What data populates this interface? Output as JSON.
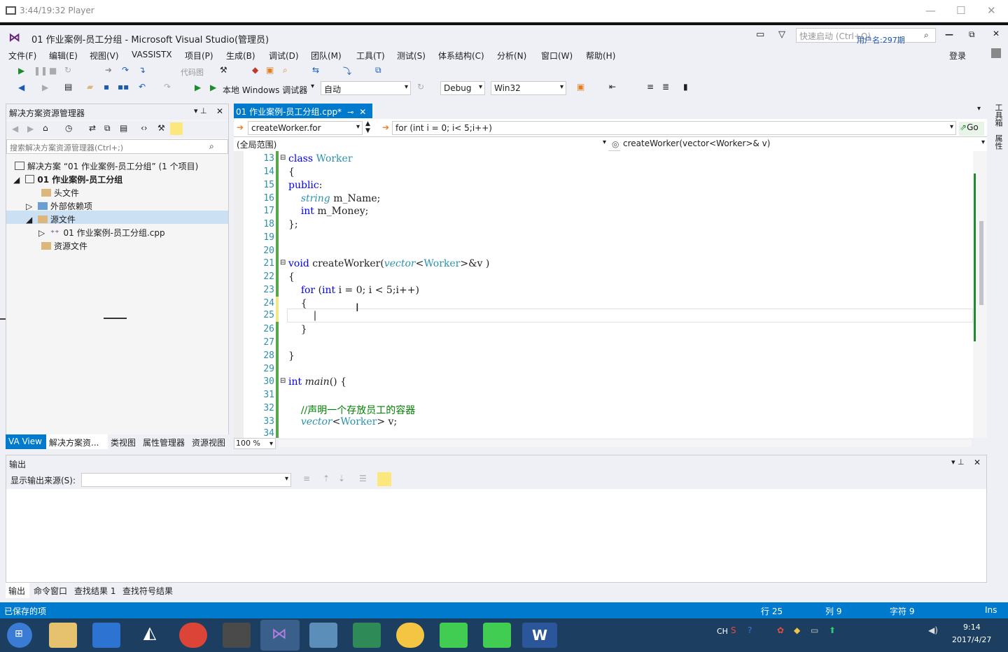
{
  "player": {
    "title": "3:44/19:32 Player"
  },
  "vs": {
    "title": "01 作业案例-员工分组 - Microsoft Visual Studio(管理员)",
    "quick_launch": "快速启动 (Ctrl+Q)",
    "username": "用户名:297期",
    "login": "登录"
  },
  "menu": [
    "文件(F)",
    "编辑(E)",
    "视图(V)",
    "VASSISTX",
    "项目(P)",
    "生成(B)",
    "调试(D)",
    "团队(M)",
    "工具(T)",
    "测试(S)",
    "体系结构(C)",
    "分析(N)",
    "窗口(W)",
    "帮助(H)"
  ],
  "toolbar": {
    "codemap": "代码图",
    "debugger": "本地 Windows 调试器",
    "auto": "自动",
    "config": "Debug",
    "platform": "Win32"
  },
  "solution": {
    "title": "解决方案资源管理器",
    "search": "搜索解决方案资源管理器(Ctrl+;)",
    "root": "解决方案 “01 作业案例-员工分组” (1 个项目)",
    "project": "01 作业案例-员工分组",
    "headers": "头文件",
    "extdeps": "外部依赖项",
    "sources": "源文件",
    "cppfile": "01 作业案例-员工分组.cpp",
    "resources": "资源文件",
    "tabs": [
      "VA View",
      "解决方案资...",
      "类视图",
      "属性管理器",
      "资源视图"
    ]
  },
  "editor": {
    "tab": "01 作业案例-员工分组.cpp*",
    "nav1": "createWorker.for",
    "nav2": "for (int i = 0; i< 5;i++)",
    "scope": "(全局范围)",
    "func": "createWorker(vector<Worker>& v)",
    "zoom": "100 %",
    "go": "Go",
    "lines": [
      "13",
      "14",
      "15",
      "16",
      "17",
      "18",
      "19",
      "20",
      "21",
      "22",
      "23",
      "24",
      "25",
      "26",
      "27",
      "28",
      "29",
      "30",
      "31",
      "32",
      "33",
      "34"
    ]
  },
  "output": {
    "title": "输出",
    "source_label": "显示输出来源(S):",
    "tabs": [
      "输出",
      "命令窗口",
      "查找结果 1",
      "查找符号结果"
    ]
  },
  "status": {
    "left": "已保存的项",
    "line": "行 25",
    "col": "列 9",
    "ch": "字符 9",
    "ins": "Ins"
  },
  "taskbar": {
    "time": "9:14",
    "date": "2017/4/27",
    "lang": "CH"
  },
  "side": {
    "tab1": "工具箱",
    "tab2": "属性"
  }
}
